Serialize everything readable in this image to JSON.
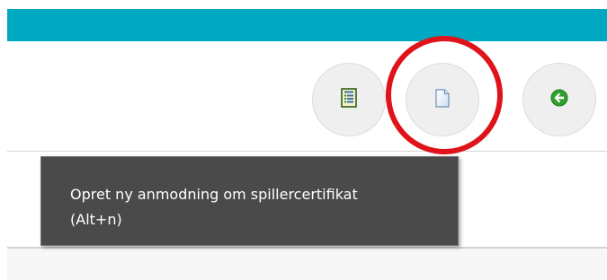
{
  "header": {
    "bar_color": "#00a9c1"
  },
  "toolbar": {
    "buttons": [
      {
        "icon": "certificate-list-icon"
      },
      {
        "icon": "new-document-icon",
        "highlighted": true
      },
      {
        "icon": "back-arrow-icon",
        "icon_color": "#2fa02f"
      }
    ],
    "highlight_color": "#e0121a"
  },
  "tooltip": {
    "line1": "Opret ny anmodning om spillercertifikat",
    "line2": "(Alt+n)"
  }
}
